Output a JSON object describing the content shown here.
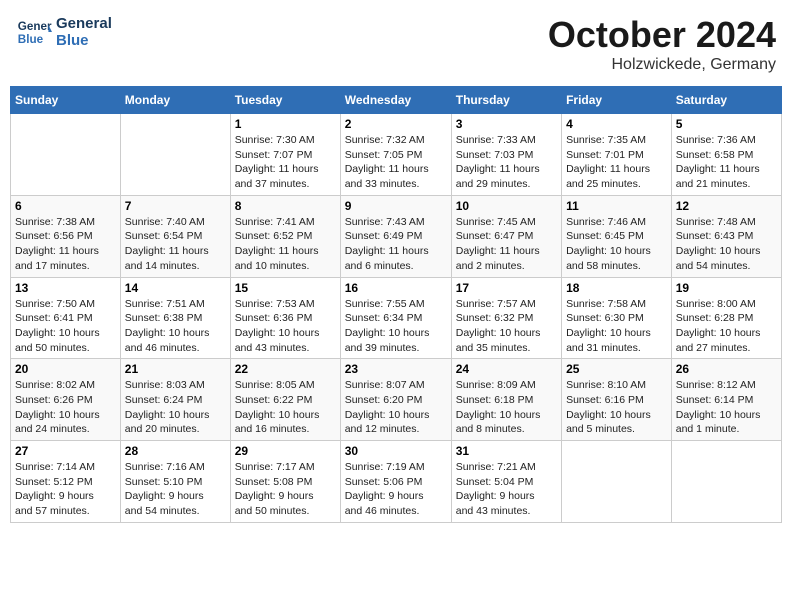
{
  "header": {
    "logo_line1": "General",
    "logo_line2": "Blue",
    "month": "October 2024",
    "location": "Holzwickede, Germany"
  },
  "days_of_week": [
    "Sunday",
    "Monday",
    "Tuesday",
    "Wednesday",
    "Thursday",
    "Friday",
    "Saturday"
  ],
  "weeks": [
    [
      {
        "day": "",
        "detail": ""
      },
      {
        "day": "",
        "detail": ""
      },
      {
        "day": "1",
        "detail": "Sunrise: 7:30 AM\nSunset: 7:07 PM\nDaylight: 11 hours\nand 37 minutes."
      },
      {
        "day": "2",
        "detail": "Sunrise: 7:32 AM\nSunset: 7:05 PM\nDaylight: 11 hours\nand 33 minutes."
      },
      {
        "day": "3",
        "detail": "Sunrise: 7:33 AM\nSunset: 7:03 PM\nDaylight: 11 hours\nand 29 minutes."
      },
      {
        "day": "4",
        "detail": "Sunrise: 7:35 AM\nSunset: 7:01 PM\nDaylight: 11 hours\nand 25 minutes."
      },
      {
        "day": "5",
        "detail": "Sunrise: 7:36 AM\nSunset: 6:58 PM\nDaylight: 11 hours\nand 21 minutes."
      }
    ],
    [
      {
        "day": "6",
        "detail": "Sunrise: 7:38 AM\nSunset: 6:56 PM\nDaylight: 11 hours\nand 17 minutes."
      },
      {
        "day": "7",
        "detail": "Sunrise: 7:40 AM\nSunset: 6:54 PM\nDaylight: 11 hours\nand 14 minutes."
      },
      {
        "day": "8",
        "detail": "Sunrise: 7:41 AM\nSunset: 6:52 PM\nDaylight: 11 hours\nand 10 minutes."
      },
      {
        "day": "9",
        "detail": "Sunrise: 7:43 AM\nSunset: 6:49 PM\nDaylight: 11 hours\nand 6 minutes."
      },
      {
        "day": "10",
        "detail": "Sunrise: 7:45 AM\nSunset: 6:47 PM\nDaylight: 11 hours\nand 2 minutes."
      },
      {
        "day": "11",
        "detail": "Sunrise: 7:46 AM\nSunset: 6:45 PM\nDaylight: 10 hours\nand 58 minutes."
      },
      {
        "day": "12",
        "detail": "Sunrise: 7:48 AM\nSunset: 6:43 PM\nDaylight: 10 hours\nand 54 minutes."
      }
    ],
    [
      {
        "day": "13",
        "detail": "Sunrise: 7:50 AM\nSunset: 6:41 PM\nDaylight: 10 hours\nand 50 minutes."
      },
      {
        "day": "14",
        "detail": "Sunrise: 7:51 AM\nSunset: 6:38 PM\nDaylight: 10 hours\nand 46 minutes."
      },
      {
        "day": "15",
        "detail": "Sunrise: 7:53 AM\nSunset: 6:36 PM\nDaylight: 10 hours\nand 43 minutes."
      },
      {
        "day": "16",
        "detail": "Sunrise: 7:55 AM\nSunset: 6:34 PM\nDaylight: 10 hours\nand 39 minutes."
      },
      {
        "day": "17",
        "detail": "Sunrise: 7:57 AM\nSunset: 6:32 PM\nDaylight: 10 hours\nand 35 minutes."
      },
      {
        "day": "18",
        "detail": "Sunrise: 7:58 AM\nSunset: 6:30 PM\nDaylight: 10 hours\nand 31 minutes."
      },
      {
        "day": "19",
        "detail": "Sunrise: 8:00 AM\nSunset: 6:28 PM\nDaylight: 10 hours\nand 27 minutes."
      }
    ],
    [
      {
        "day": "20",
        "detail": "Sunrise: 8:02 AM\nSunset: 6:26 PM\nDaylight: 10 hours\nand 24 minutes."
      },
      {
        "day": "21",
        "detail": "Sunrise: 8:03 AM\nSunset: 6:24 PM\nDaylight: 10 hours\nand 20 minutes."
      },
      {
        "day": "22",
        "detail": "Sunrise: 8:05 AM\nSunset: 6:22 PM\nDaylight: 10 hours\nand 16 minutes."
      },
      {
        "day": "23",
        "detail": "Sunrise: 8:07 AM\nSunset: 6:20 PM\nDaylight: 10 hours\nand 12 minutes."
      },
      {
        "day": "24",
        "detail": "Sunrise: 8:09 AM\nSunset: 6:18 PM\nDaylight: 10 hours\nand 8 minutes."
      },
      {
        "day": "25",
        "detail": "Sunrise: 8:10 AM\nSunset: 6:16 PM\nDaylight: 10 hours\nand 5 minutes."
      },
      {
        "day": "26",
        "detail": "Sunrise: 8:12 AM\nSunset: 6:14 PM\nDaylight: 10 hours\nand 1 minute."
      }
    ],
    [
      {
        "day": "27",
        "detail": "Sunrise: 7:14 AM\nSunset: 5:12 PM\nDaylight: 9 hours\nand 57 minutes."
      },
      {
        "day": "28",
        "detail": "Sunrise: 7:16 AM\nSunset: 5:10 PM\nDaylight: 9 hours\nand 54 minutes."
      },
      {
        "day": "29",
        "detail": "Sunrise: 7:17 AM\nSunset: 5:08 PM\nDaylight: 9 hours\nand 50 minutes."
      },
      {
        "day": "30",
        "detail": "Sunrise: 7:19 AM\nSunset: 5:06 PM\nDaylight: 9 hours\nand 46 minutes."
      },
      {
        "day": "31",
        "detail": "Sunrise: 7:21 AM\nSunset: 5:04 PM\nDaylight: 9 hours\nand 43 minutes."
      },
      {
        "day": "",
        "detail": ""
      },
      {
        "day": "",
        "detail": ""
      }
    ]
  ]
}
